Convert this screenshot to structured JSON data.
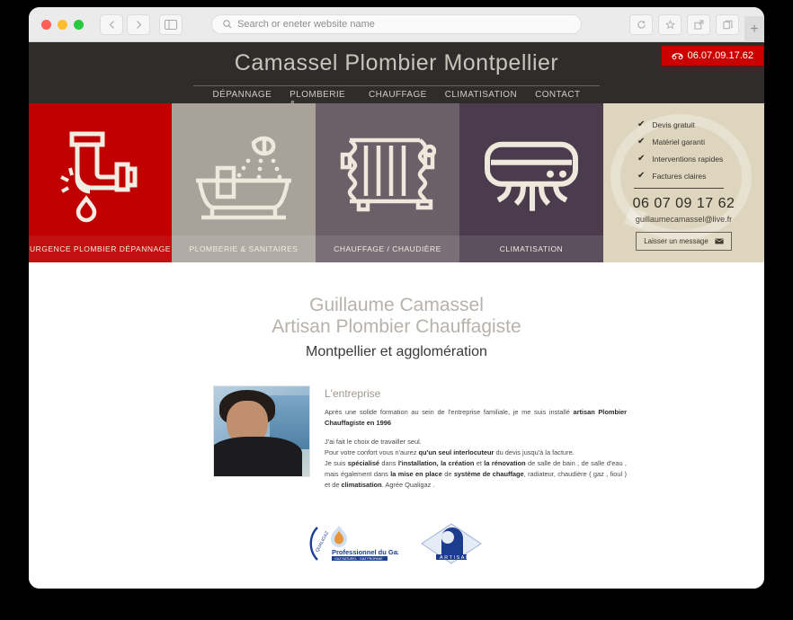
{
  "browser": {
    "url_placeholder": "Search or eneter website name",
    "search_icon": "search-icon",
    "back_icon": "chevron-left-icon",
    "forward_icon": "chevron-right-icon",
    "sidebar_icon": "sidebar-icon",
    "reload_icon": "reload-icon",
    "bookmark_icon": "star-icon",
    "share_icon": "share-icon",
    "tabs_icon": "tabs-icon",
    "newtab_label": "+"
  },
  "header": {
    "brand": "Camassel Plombier Montpellier",
    "phone_badge": "06.07.09.17.62",
    "phone_icon": "telephone-icon",
    "nav": [
      "DÉPANNAGE",
      "PLOMBERIE & SANITAIRES",
      "CHAUFFAGE",
      "CLIMATISATION",
      "CONTACT"
    ]
  },
  "tiles": [
    {
      "label": "URGENCE PLOMBIER DÉPANNAGE",
      "icon": "leaking-pipe-icon",
      "color": "#c00000"
    },
    {
      "label": "PLOMBERIE & SANITAIRES",
      "icon": "bathtub-shower-icon",
      "color": "#a9a29b"
    },
    {
      "label": "CHAUFFAGE / CHAUDIÈRE",
      "icon": "radiator-icon",
      "color": "#6b5f68"
    },
    {
      "label": "CLIMATISATION",
      "icon": "air-conditioner-icon",
      "color": "#4a3c4c"
    }
  ],
  "sidepanel": {
    "items": [
      "Devis gratuit",
      "Matériel garanti",
      "Interventions rapides",
      "Factures claires"
    ],
    "check_icon": "check-icon",
    "phone": "06 07 09 17 62",
    "email": "guillaumecamassel@live.fr",
    "button_label": "Laisser un message",
    "button_icon": "envelope-icon"
  },
  "hero": {
    "name": "Guillaume Camassel",
    "job": "Artisan Plombier Chauffagiste",
    "area": "Montpellier et agglomération"
  },
  "about": {
    "title": "L'entreprise",
    "photo_alt": "portrait-photo",
    "p1_a": "Après une solide formation au sein de l'entreprise familiale, je me suis installé ",
    "p1_b": "artisan Plombier Chauffagiste en 1996",
    "p2_l1": "J'ai fait le choix de travailler seul.",
    "p2_l2_a": "Pour votre confort vous n'aurez ",
    "p2_l2_b": "qu'un seul interlocuteur",
    "p2_l2_c": " du devis jusqu'à la facture.",
    "p2_l3_a": "Je suis ",
    "p2_l3_b": "spécialisé",
    "p2_l3_c": " dans ",
    "p2_l3_d": "l'installation, la création",
    "p2_l3_e": " et ",
    "p2_l3_f": "la rénovation",
    "p2_l3_g": " de salle de bain , de salle d'eau , mais également dans ",
    "p2_l3_h": "la mise en place",
    "p2_l3_i": " de ",
    "p2_l3_j": "système de chauffage",
    "p2_l3_k": ", radiateur, chaudière ( gaz , fioul ) et de ",
    "p2_l3_l": "climatisation",
    "p2_l3_m": ". Agrée Qualigaz ."
  },
  "logos": [
    {
      "name": "professionnel-du-gaz-logo",
      "text": "Professionnel du Gaz",
      "sub": "GAZ NATUREL · GAZ PROPANE",
      "ring": "QUALIGAZ"
    },
    {
      "name": "artisan-logo",
      "text": "ARTISAN"
    }
  ]
}
